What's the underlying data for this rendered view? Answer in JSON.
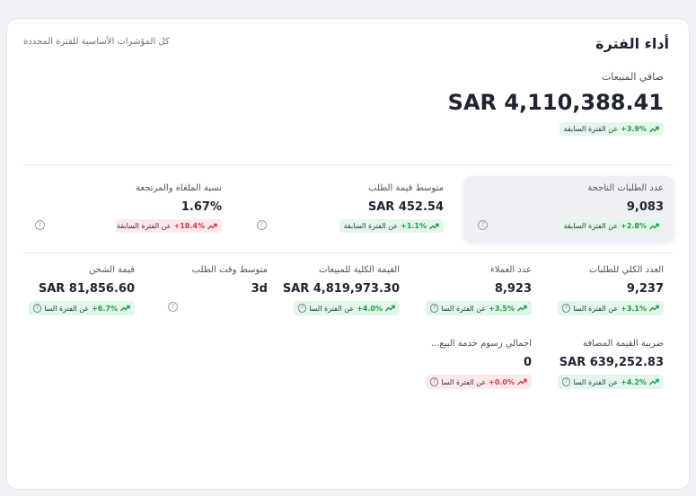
{
  "header": {
    "title": "أداء الفترة",
    "subtitle": "كل المؤشرات الأساسية للفترة المحددة"
  },
  "hero": {
    "label": "صافي المبيعات",
    "value": "SAR 4,110,388.41",
    "change": {
      "pct": "+3.9%",
      "text": "عن الفترة السابقة",
      "direction": "up"
    }
  },
  "row1": [
    {
      "label": "عدد الطلبات الناجحة",
      "value": "9,083",
      "change": {
        "pct": "+2.8%",
        "text": "عن الفترة السابقة",
        "direction": "up"
      }
    },
    {
      "label": "متوسط قيمة الطلب",
      "value": "SAR 452.54",
      "change": {
        "pct": "+1.1%",
        "text": "عن الفترة السابقة",
        "direction": "up"
      }
    },
    {
      "label": "نسبة الملغاة والمرتجعة",
      "value": "1.67%",
      "change": {
        "pct": "+18.4%",
        "text": "عن الفترة السابقة",
        "direction": "down"
      }
    }
  ],
  "row2": [
    {
      "label": "العدد الكلي للطلبات",
      "value": "9,237",
      "change": {
        "pct": "+3.1%",
        "text": "عن الفترة السا",
        "direction": "up"
      }
    },
    {
      "label": "عدد العملاء",
      "value": "8,923",
      "change": {
        "pct": "+3.5%",
        "text": "عن الفترة السا",
        "direction": "up"
      }
    },
    {
      "label": "القيمة الكلية للمبيعات",
      "value": "SAR 4,819,973.30",
      "change": {
        "pct": "+4.0%",
        "text": "عن الفترة السا",
        "direction": "up"
      }
    },
    {
      "label": "متوسط وقت الطلب",
      "value": "3d"
    },
    {
      "label": "قيمة الشحن",
      "value": "SAR 81,856.60",
      "change": {
        "pct": "+6.7%",
        "text": "عن الفترة السا",
        "direction": "up"
      }
    }
  ],
  "row3": [
    {
      "label": "ضريبة القيمة المضافة",
      "value": "SAR 639,252.83",
      "change": {
        "pct": "+4.2%",
        "text": "عن الفترة السا",
        "direction": "up"
      }
    },
    {
      "label": "اجمالي رسوم خدمة البيع...",
      "value": "0",
      "change": {
        "pct": "+0.0%",
        "text": "عن الفترة السا",
        "direction": "down"
      }
    }
  ],
  "icons": {
    "trend": "trend-arrow-icon",
    "help": "help-circle-icon"
  },
  "colors": {
    "up": "#1e9a4a",
    "down": "#d6364a",
    "up_bg": "#e3f6ea",
    "down_bg": "#fde8ea"
  }
}
